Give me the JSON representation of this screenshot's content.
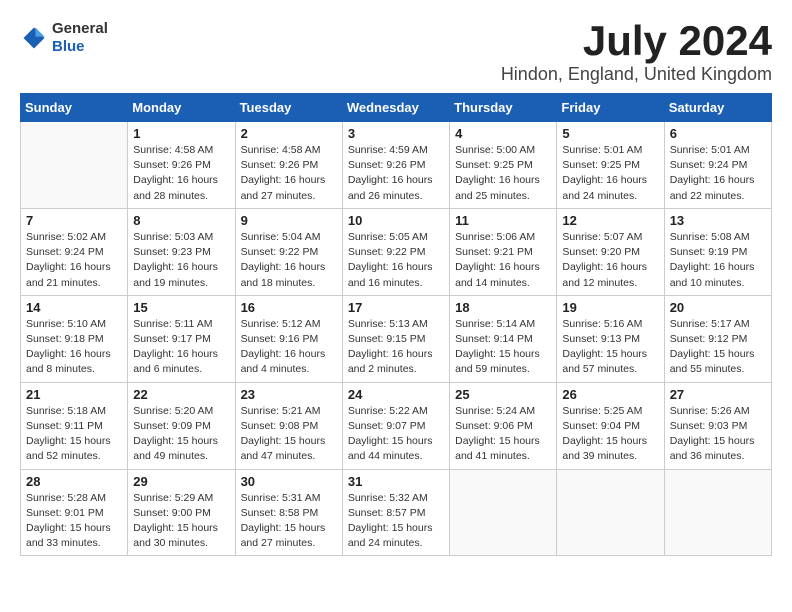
{
  "header": {
    "logo_general": "General",
    "logo_blue": "Blue",
    "month_title": "July 2024",
    "location": "Hindon, England, United Kingdom"
  },
  "weekdays": [
    "Sunday",
    "Monday",
    "Tuesday",
    "Wednesday",
    "Thursday",
    "Friday",
    "Saturday"
  ],
  "weeks": [
    [
      {
        "day": "",
        "info": ""
      },
      {
        "day": "1",
        "info": "Sunrise: 4:58 AM\nSunset: 9:26 PM\nDaylight: 16 hours\nand 28 minutes."
      },
      {
        "day": "2",
        "info": "Sunrise: 4:58 AM\nSunset: 9:26 PM\nDaylight: 16 hours\nand 27 minutes."
      },
      {
        "day": "3",
        "info": "Sunrise: 4:59 AM\nSunset: 9:26 PM\nDaylight: 16 hours\nand 26 minutes."
      },
      {
        "day": "4",
        "info": "Sunrise: 5:00 AM\nSunset: 9:25 PM\nDaylight: 16 hours\nand 25 minutes."
      },
      {
        "day": "5",
        "info": "Sunrise: 5:01 AM\nSunset: 9:25 PM\nDaylight: 16 hours\nand 24 minutes."
      },
      {
        "day": "6",
        "info": "Sunrise: 5:01 AM\nSunset: 9:24 PM\nDaylight: 16 hours\nand 22 minutes."
      }
    ],
    [
      {
        "day": "7",
        "info": "Sunrise: 5:02 AM\nSunset: 9:24 PM\nDaylight: 16 hours\nand 21 minutes."
      },
      {
        "day": "8",
        "info": "Sunrise: 5:03 AM\nSunset: 9:23 PM\nDaylight: 16 hours\nand 19 minutes."
      },
      {
        "day": "9",
        "info": "Sunrise: 5:04 AM\nSunset: 9:22 PM\nDaylight: 16 hours\nand 18 minutes."
      },
      {
        "day": "10",
        "info": "Sunrise: 5:05 AM\nSunset: 9:22 PM\nDaylight: 16 hours\nand 16 minutes."
      },
      {
        "day": "11",
        "info": "Sunrise: 5:06 AM\nSunset: 9:21 PM\nDaylight: 16 hours\nand 14 minutes."
      },
      {
        "day": "12",
        "info": "Sunrise: 5:07 AM\nSunset: 9:20 PM\nDaylight: 16 hours\nand 12 minutes."
      },
      {
        "day": "13",
        "info": "Sunrise: 5:08 AM\nSunset: 9:19 PM\nDaylight: 16 hours\nand 10 minutes."
      }
    ],
    [
      {
        "day": "14",
        "info": "Sunrise: 5:10 AM\nSunset: 9:18 PM\nDaylight: 16 hours\nand 8 minutes."
      },
      {
        "day": "15",
        "info": "Sunrise: 5:11 AM\nSunset: 9:17 PM\nDaylight: 16 hours\nand 6 minutes."
      },
      {
        "day": "16",
        "info": "Sunrise: 5:12 AM\nSunset: 9:16 PM\nDaylight: 16 hours\nand 4 minutes."
      },
      {
        "day": "17",
        "info": "Sunrise: 5:13 AM\nSunset: 9:15 PM\nDaylight: 16 hours\nand 2 minutes."
      },
      {
        "day": "18",
        "info": "Sunrise: 5:14 AM\nSunset: 9:14 PM\nDaylight: 15 hours\nand 59 minutes."
      },
      {
        "day": "19",
        "info": "Sunrise: 5:16 AM\nSunset: 9:13 PM\nDaylight: 15 hours\nand 57 minutes."
      },
      {
        "day": "20",
        "info": "Sunrise: 5:17 AM\nSunset: 9:12 PM\nDaylight: 15 hours\nand 55 minutes."
      }
    ],
    [
      {
        "day": "21",
        "info": "Sunrise: 5:18 AM\nSunset: 9:11 PM\nDaylight: 15 hours\nand 52 minutes."
      },
      {
        "day": "22",
        "info": "Sunrise: 5:20 AM\nSunset: 9:09 PM\nDaylight: 15 hours\nand 49 minutes."
      },
      {
        "day": "23",
        "info": "Sunrise: 5:21 AM\nSunset: 9:08 PM\nDaylight: 15 hours\nand 47 minutes."
      },
      {
        "day": "24",
        "info": "Sunrise: 5:22 AM\nSunset: 9:07 PM\nDaylight: 15 hours\nand 44 minutes."
      },
      {
        "day": "25",
        "info": "Sunrise: 5:24 AM\nSunset: 9:06 PM\nDaylight: 15 hours\nand 41 minutes."
      },
      {
        "day": "26",
        "info": "Sunrise: 5:25 AM\nSunset: 9:04 PM\nDaylight: 15 hours\nand 39 minutes."
      },
      {
        "day": "27",
        "info": "Sunrise: 5:26 AM\nSunset: 9:03 PM\nDaylight: 15 hours\nand 36 minutes."
      }
    ],
    [
      {
        "day": "28",
        "info": "Sunrise: 5:28 AM\nSunset: 9:01 PM\nDaylight: 15 hours\nand 33 minutes."
      },
      {
        "day": "29",
        "info": "Sunrise: 5:29 AM\nSunset: 9:00 PM\nDaylight: 15 hours\nand 30 minutes."
      },
      {
        "day": "30",
        "info": "Sunrise: 5:31 AM\nSunset: 8:58 PM\nDaylight: 15 hours\nand 27 minutes."
      },
      {
        "day": "31",
        "info": "Sunrise: 5:32 AM\nSunset: 8:57 PM\nDaylight: 15 hours\nand 24 minutes."
      },
      {
        "day": "",
        "info": ""
      },
      {
        "day": "",
        "info": ""
      },
      {
        "day": "",
        "info": ""
      }
    ]
  ]
}
